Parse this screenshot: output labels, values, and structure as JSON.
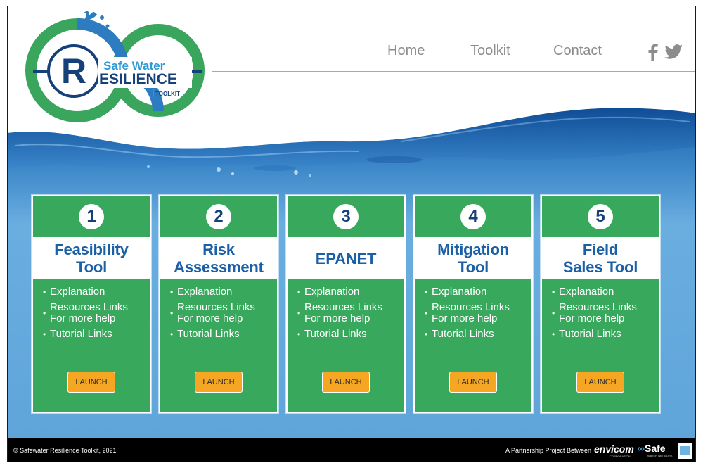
{
  "logo": {
    "title_top": "Safe Water",
    "title_main": "ESILIENCE",
    "letter": "R",
    "subtitle": "TOOLKIT"
  },
  "nav": {
    "links": [
      "Home",
      "Toolkit",
      "Contact"
    ],
    "social": [
      "facebook-icon",
      "twitter-icon"
    ]
  },
  "cards": [
    {
      "number": "1",
      "title": "Feasibility\nTool",
      "bullets": [
        "Explanation",
        "Resources Links\nFor more help",
        "Tutorial Links"
      ],
      "button": "LAUNCH"
    },
    {
      "number": "2",
      "title": "Risk\nAssessment",
      "bullets": [
        "Explanation",
        "Resources Links\nFor more help",
        "Tutorial Links"
      ],
      "button": "LAUNCH"
    },
    {
      "number": "3",
      "title": "EPANET",
      "bullets": [
        "Explanation",
        "Resources Links\nFor more help",
        "Tutorial Links"
      ],
      "button": "LAUNCH"
    },
    {
      "number": "4",
      "title": "Mitigation\nTool",
      "bullets": [
        "Explanation",
        "Resources Links\nFor more help",
        "Tutorial Links"
      ],
      "button": "LAUNCH"
    },
    {
      "number": "5",
      "title": "Field\nSales Tool",
      "bullets": [
        "Explanation",
        "Resources Links\nFor more help",
        "Tutorial Links"
      ],
      "button": "LAUNCH"
    }
  ],
  "footer": {
    "copyright": "© Safewater Resilience Toolkit, 2021",
    "partnership": "A Partnership Project Between",
    "partner1": "envicom",
    "partner1_sub": "CORPORATION",
    "partner2": "Safe",
    "partner2_sub": "WATER NETWORK"
  },
  "colors": {
    "green": "#38a85d",
    "title_blue": "#1b5fa6",
    "launch_orange": "#f5a623",
    "water_blue": "#5ea6db"
  }
}
